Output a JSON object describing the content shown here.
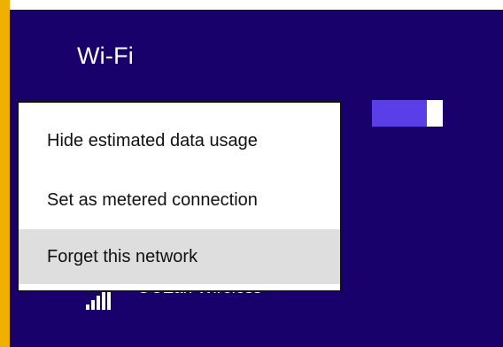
{
  "panel": {
    "title": "Wi-Fi",
    "wifi_toggle": {
      "state": "on"
    },
    "network": {
      "name": "OCEan Wireless",
      "signal_icon": "wifi-signal-bars-icon"
    }
  },
  "context_menu": {
    "items": [
      {
        "label": "Hide estimated data usage"
      },
      {
        "label": "Set as metered connection"
      },
      {
        "label": "Forget this network"
      }
    ]
  },
  "colors": {
    "panel_background": "#19016b",
    "accent_edge": "#f0b000",
    "toggle_track": "#5a3ee8",
    "menu_hover": "#dedede"
  }
}
